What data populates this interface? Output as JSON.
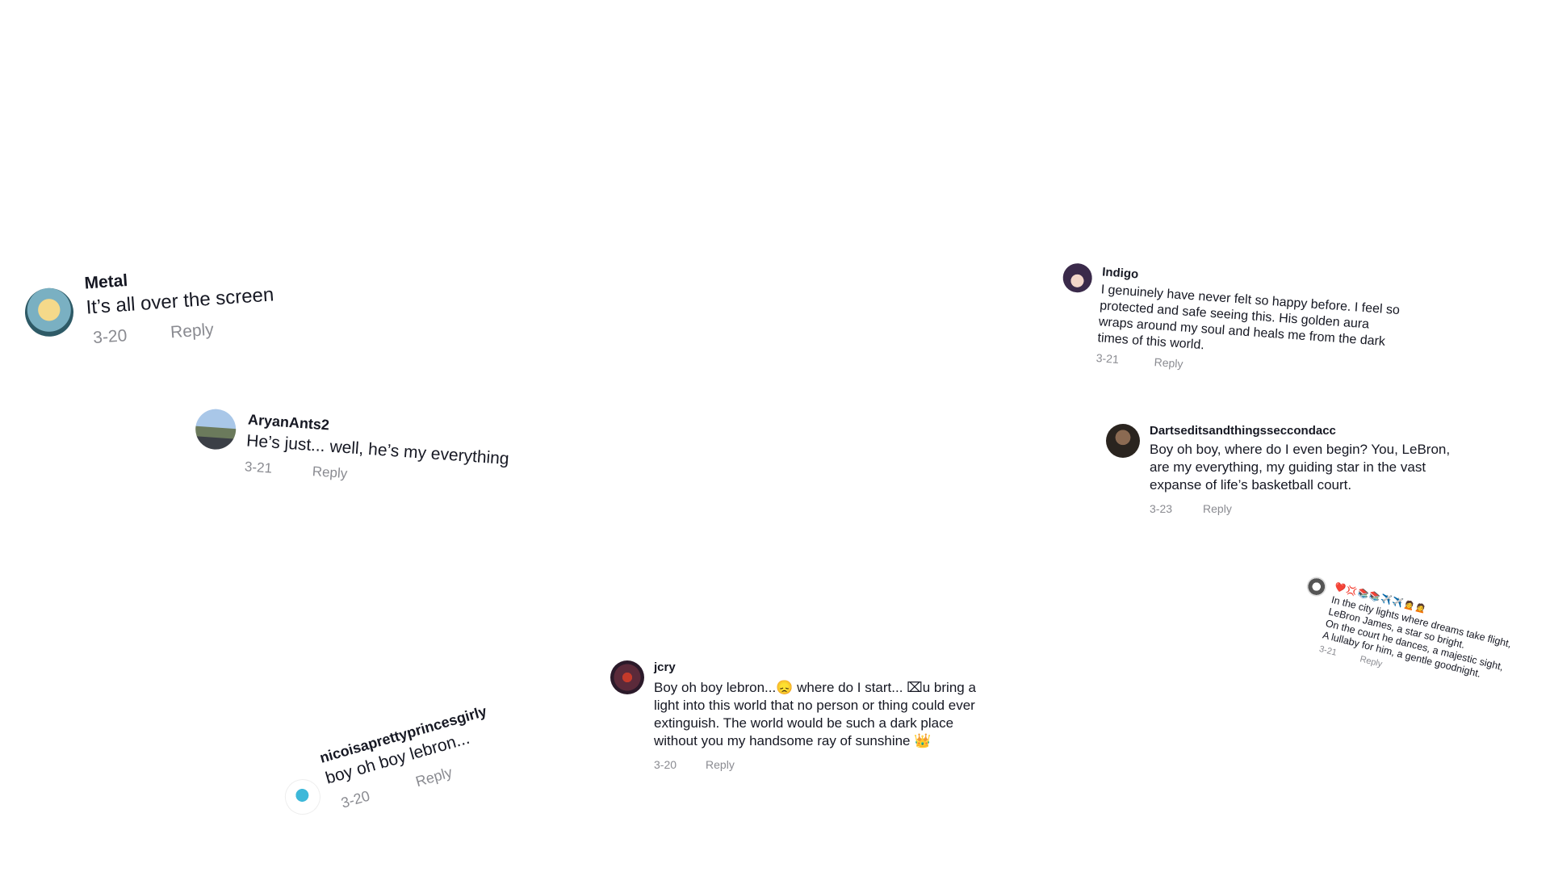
{
  "comments": [
    {
      "username": "Metal",
      "text": "It’s all over the screen",
      "date": "3-20",
      "reply": "Reply"
    },
    {
      "username": "AryanAnts2",
      "text": "He’s just... well, he’s my everything",
      "date": "3-21",
      "reply": "Reply"
    },
    {
      "username": "Indigo",
      "text": "I genuinely have never felt so happy before. I feel so protected and safe seeing this. His golden aura wraps around my soul and heals me from the dark times of this world.",
      "date": "3-21",
      "reply": "Reply"
    },
    {
      "username": "Dartseditsandthingsseccondacc",
      "text": "Boy oh boy, where do I even begin? You, LeBron, are my everything, my guiding star in the vast expanse of life’s basketball court.",
      "date": "3-23",
      "reply": "Reply"
    },
    {
      "username": "❤️💢📚📚✈️✈️🙍🙍",
      "text": "In the city lights where dreams take flight,\nLeBron James, a star so bright.\nOn the court he dances, a majestic sight,\nA lullaby for him, a gentle goodnight.",
      "date": "3-21",
      "reply": "Reply"
    },
    {
      "username": "nicoisaprettyprincesgirly",
      "text": "boy oh boy lebron...",
      "date": "3-20",
      "reply": "Reply"
    },
    {
      "username": "jcry",
      "text": "Boy oh boy lebron...😞 where do I start... ⌧u bring a light into this world that no person or thing could ever extinguish. The world would be such a dark place without you my handsome ray of sunshine 👑",
      "date": "3-20",
      "reply": "Reply"
    }
  ]
}
